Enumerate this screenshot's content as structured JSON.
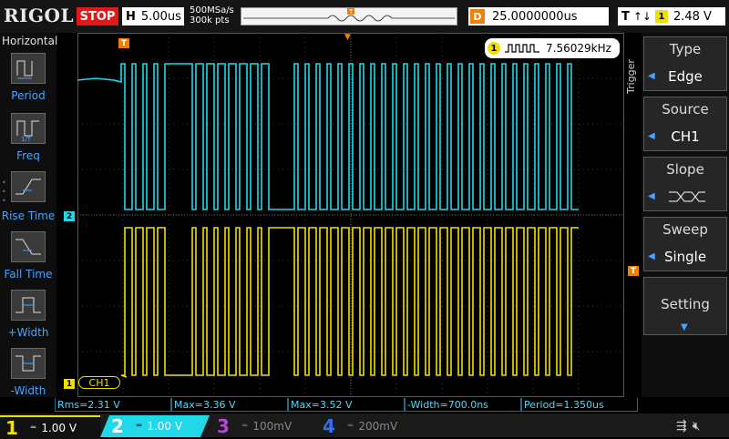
{
  "topbar": {
    "logo": "RIGOL",
    "run_state": "STOP",
    "horizontal_label": "H",
    "timebase": "5.00us",
    "sample_rate": "500MSa/s",
    "memory_depth": "300k pts",
    "delay_label": "D",
    "delay_value": "25.0000000us",
    "trigger_label": "T",
    "trigger_source": "1",
    "trigger_level": "2.48 V"
  },
  "left_menu": {
    "title": "Horizontal",
    "items": [
      "Period",
      "Freq",
      "Rise Time",
      "Fall Time",
      "+Width",
      "-Width"
    ]
  },
  "right_menu": {
    "side_label": "Trigger",
    "panels": [
      {
        "title": "Type",
        "value": "Edge"
      },
      {
        "title": "Source",
        "value": "CH1"
      },
      {
        "title": "Slope",
        "value": ""
      },
      {
        "title": "Sweep",
        "value": "Single"
      },
      {
        "title": "Setting",
        "value": ""
      }
    ]
  },
  "frequency_counter": {
    "channel": "1",
    "value": "7.56029kHz"
  },
  "screen_labels": {
    "ch1_tag": "CH1",
    "ch1_marker": "1",
    "ch2_marker": "2",
    "trigger_marker": "T"
  },
  "measurements": [
    {
      "text": "Rms=2.31 V"
    },
    {
      "text": "Max=3.36 V"
    },
    {
      "text": "Max=3.52 V"
    },
    {
      "text": "-Width=700.0ns"
    },
    {
      "text": "Period=1.350us"
    }
  ],
  "channels": [
    {
      "num": "1",
      "scale": "1.00 V",
      "color": "#f0e000",
      "active": true
    },
    {
      "num": "2",
      "scale": "1.00 V",
      "color": "#20d8e8",
      "active": true
    },
    {
      "num": "3",
      "scale": "100mV",
      "color": "#b04ad0",
      "active": false
    },
    {
      "num": "4",
      "scale": "200mV",
      "color": "#3070f0",
      "active": false
    }
  ],
  "colors": {
    "ch1": "#f0e000",
    "ch2": "#20d8e8",
    "accent": "#4aa3ff",
    "trigger": "#f08000"
  }
}
